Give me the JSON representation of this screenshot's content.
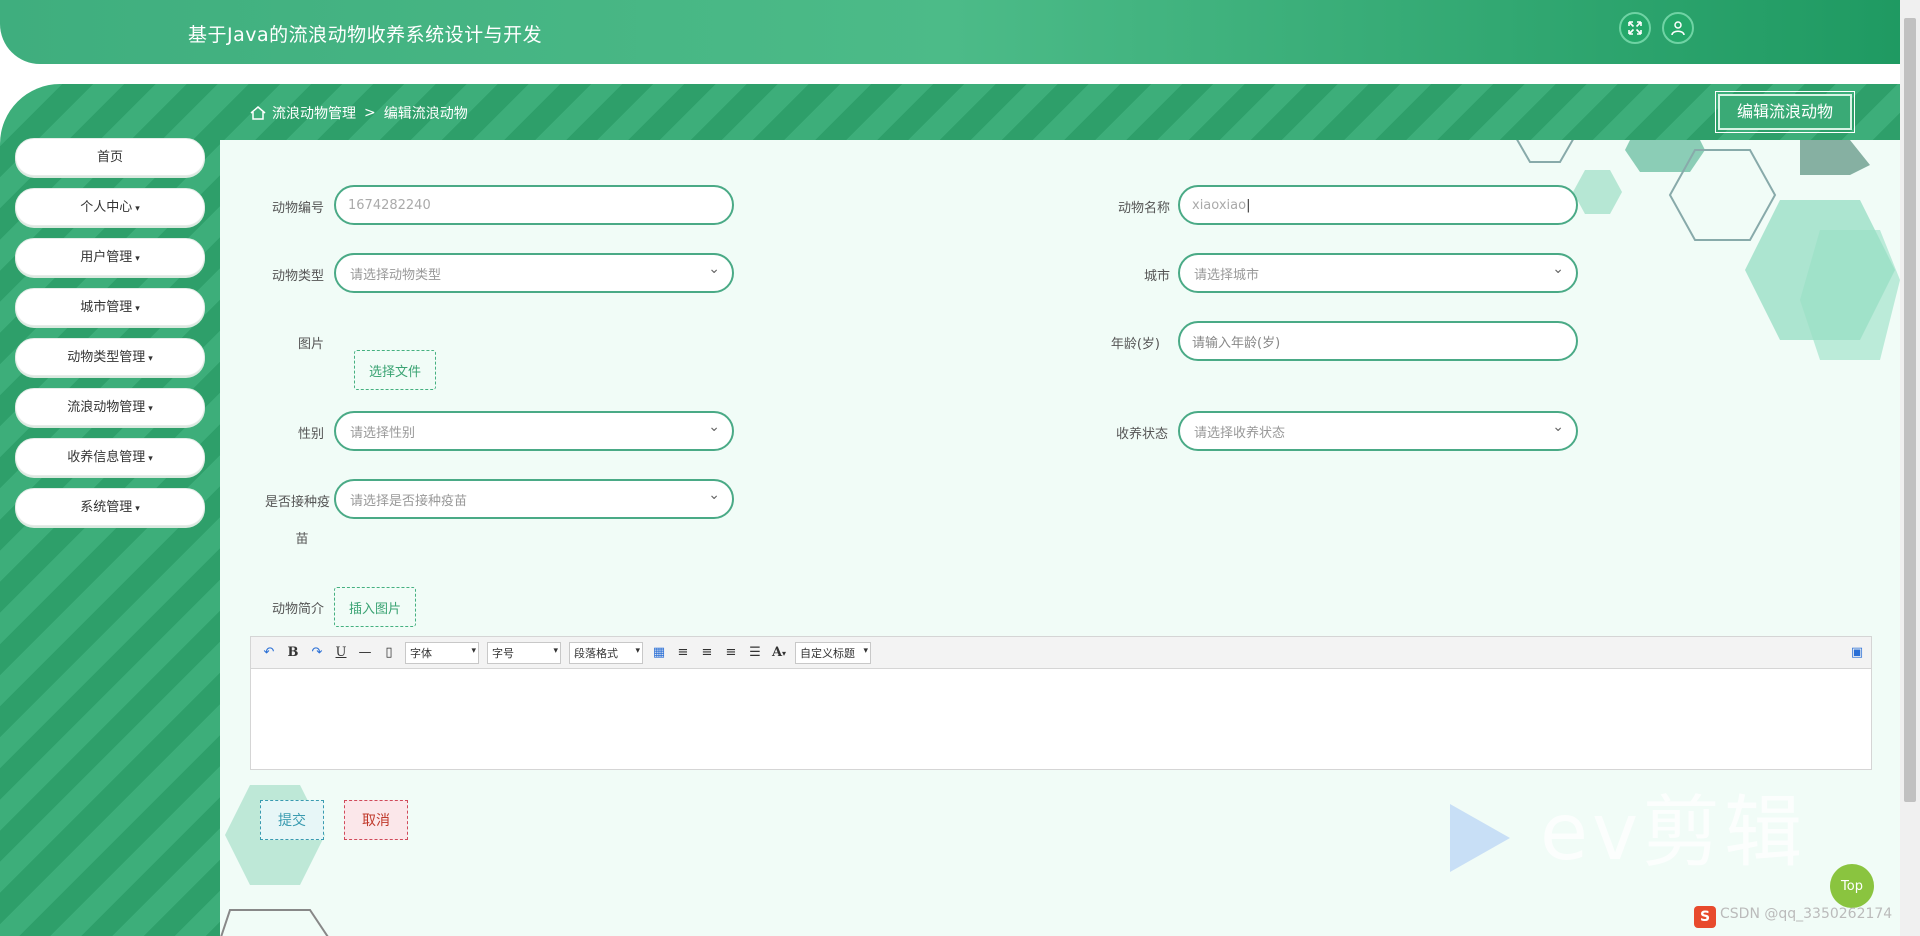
{
  "app": {
    "title": "基于Java的流浪动物收养系统设计与开发"
  },
  "header": {
    "fullscreen_icon": "expand-arrows-icon",
    "user_icon": "user-icon"
  },
  "breadcrumb": {
    "home_icon": "home-icon",
    "parent": "流浪动物管理",
    "separator": ">",
    "current": "编辑流浪动物"
  },
  "page_button": "编辑流浪动物",
  "sidebar": {
    "items": [
      {
        "label": "首页",
        "has_caret": false
      },
      {
        "label": "个人中心",
        "has_caret": true
      },
      {
        "label": "用户管理",
        "has_caret": true
      },
      {
        "label": "城市管理",
        "has_caret": true
      },
      {
        "label": "动物类型管理",
        "has_caret": true
      },
      {
        "label": "流浪动物管理",
        "has_caret": true
      },
      {
        "label": "收养信息管理",
        "has_caret": true
      },
      {
        "label": "系统管理",
        "has_caret": true
      }
    ],
    "caret": "▾"
  },
  "form": {
    "animal_id": {
      "label": "动物编号",
      "value": "1674282240"
    },
    "animal_name": {
      "label": "动物名称",
      "value": "xiaoxiao"
    },
    "animal_type": {
      "label": "动物类型",
      "placeholder": "请选择动物类型"
    },
    "city": {
      "label": "城市",
      "placeholder": "请选择城市"
    },
    "image": {
      "label": "图片",
      "button": "选择文件"
    },
    "age": {
      "label": "年龄(岁)",
      "placeholder": "请输入年龄(岁)"
    },
    "gender": {
      "label": "性别",
      "placeholder": "请选择性别"
    },
    "adoption_status": {
      "label": "收养状态",
      "placeholder": "请选择收养状态"
    },
    "vaccinated": {
      "label_line1": "是否接种疫",
      "label_line2": "苗",
      "placeholder": "请选择是否接种疫苗"
    },
    "intro": {
      "label": "动物简介",
      "insert_button": "插入图片"
    }
  },
  "editor": {
    "font_select": "字体",
    "size_select": "字号",
    "paragraph_select": "段落格式",
    "custom_title_select": "自定义标题",
    "font_color_glyph": "A"
  },
  "actions": {
    "submit": "提交",
    "cancel": "取消"
  },
  "floating": {
    "top_button": "Top",
    "watermark": "ev剪辑",
    "csdn": "CSDN @qq_3350262174"
  },
  "colors": {
    "primary_green": "#3fae7e",
    "field_border": "#4aaa86",
    "content_bg": "#f1fcf7",
    "top_button": "#8ac43f",
    "cancel_red": "#c0392b"
  }
}
